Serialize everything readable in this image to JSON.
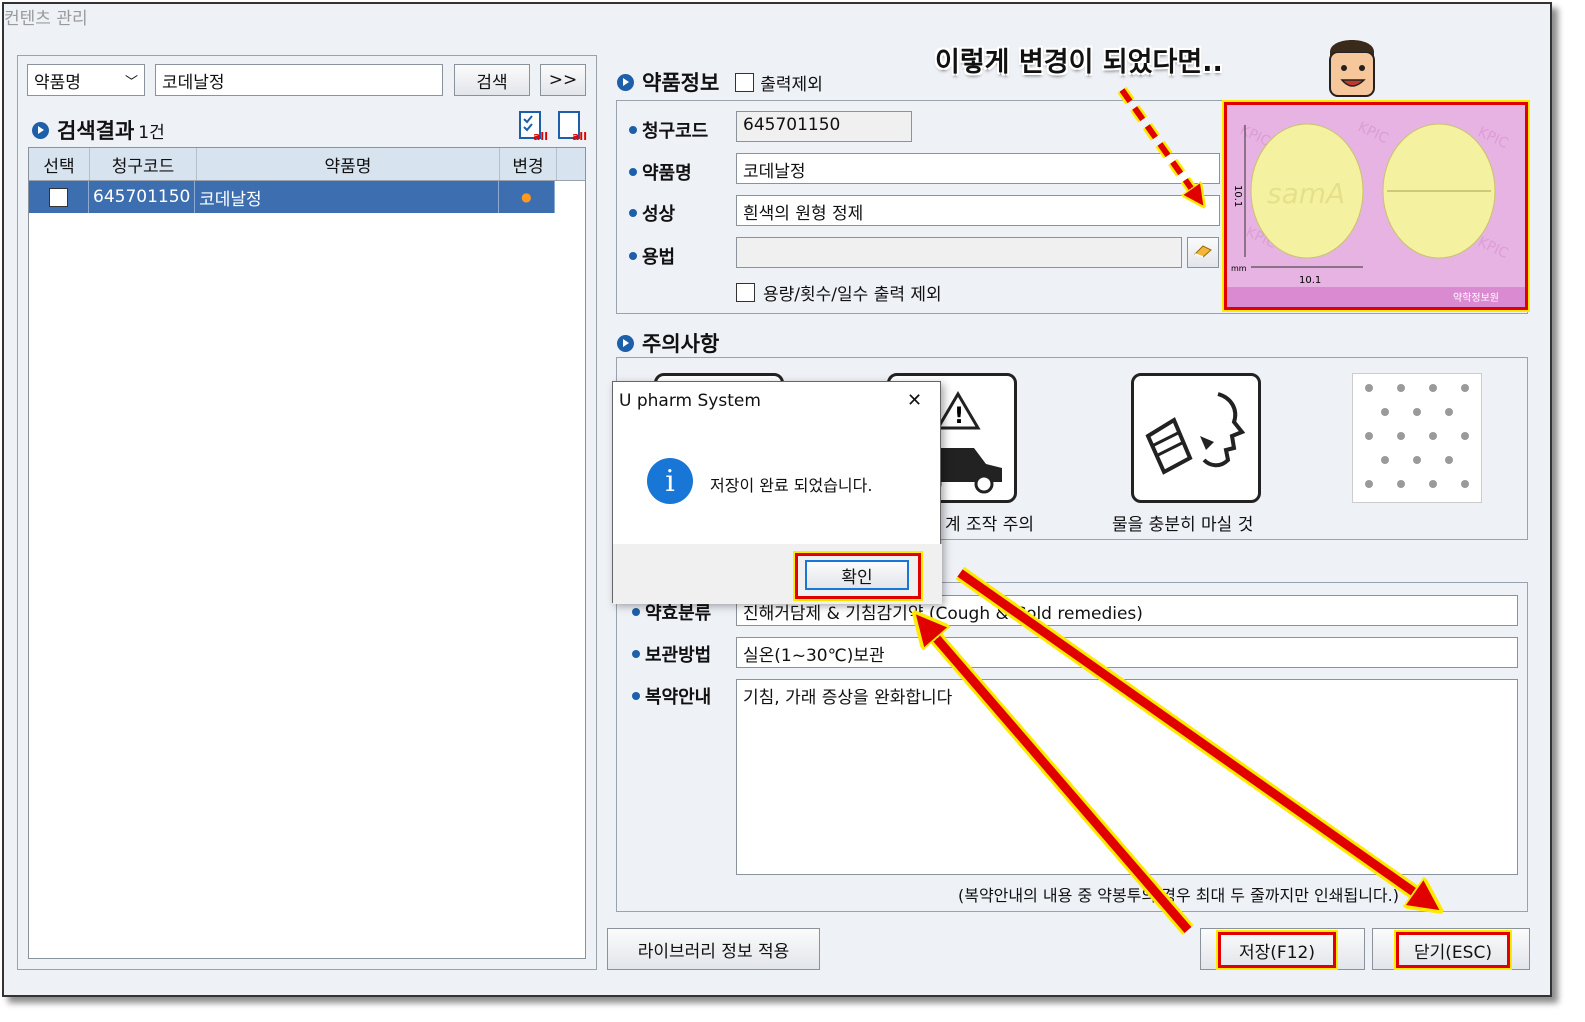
{
  "window": {
    "title": "컨텐츠 관리"
  },
  "search": {
    "type_select": "약품명",
    "query": "코데날정",
    "search_button": "검색",
    "expand_button": ">>"
  },
  "results": {
    "title": "검색결과",
    "count": "1건",
    "columns": [
      "선택",
      "청구코드",
      "약품명",
      "변경"
    ],
    "rows": [
      {
        "code": "645701150",
        "name": "코데날정",
        "changed": "●"
      }
    ]
  },
  "drug_info": {
    "title": "약품정보",
    "exclude_print_label": "출력제외",
    "code_label": "청구코드",
    "code": "645701150",
    "name_label": "약품명",
    "name": "코데날정",
    "appearance_label": "성상",
    "appearance": "흰색의 원형 정제",
    "usage_label": "용법",
    "usage": "",
    "exclude_dose_label": "용량/횟수/일수 출력 제외"
  },
  "pill_image": {
    "imprint": "samA",
    "dimension_h": "10.1",
    "dimension_w": "10.1",
    "unit": "mm",
    "watermark": "KPIC",
    "source": "약학정보원"
  },
  "caution": {
    "title": "주의사항",
    "items": [
      {
        "label": ""
      },
      {
        "label": "계 조작 주의"
      },
      {
        "label": "물을 충분히 마실 것"
      },
      {
        "label": ""
      }
    ]
  },
  "detail": {
    "class_label": "약효분류",
    "class_value": "진해거담제 & 기침감기약 (Cough & Cold remedies)",
    "storage_label": "보관방법",
    "storage_value": "실온(1~30℃)보관",
    "guide_label": "복약안내",
    "guide_value": "기침, 가래 증상을 완화합니다",
    "note": "(복약안내의 내용 중 약봉투의 경우 최대 두 줄까지만 인쇄됩니다.)"
  },
  "buttons": {
    "library": "라이브러리 정보 적용",
    "save": "저장(F12)",
    "close": "닫기(ESC)"
  },
  "dialog": {
    "title": "U pharm System",
    "message": "저장이 완료 되었습니다.",
    "ok": "확인",
    "close_glyph": "✕"
  },
  "annotation": {
    "text": "이렇게 변경이 되었다면.."
  },
  "colors": {
    "accent": "#1d5fa8",
    "selection": "#3d6fb0",
    "highlight": "#e00000",
    "highlight_glow": "#ffea00",
    "pill_bg": "#e7b3e2"
  }
}
